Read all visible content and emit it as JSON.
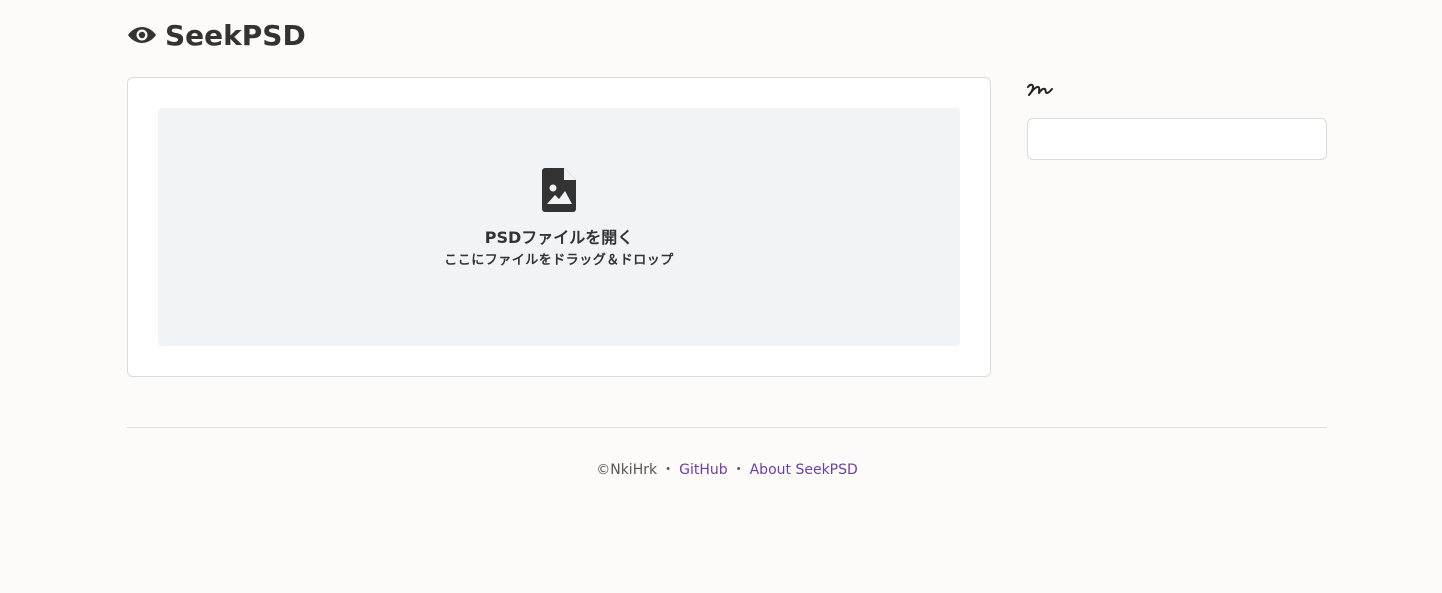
{
  "header": {
    "icon": "eye-icon",
    "title": "SeekPSD"
  },
  "dropzone": {
    "icon": "file-image-icon",
    "label_main": "PSDファイルを開く",
    "label_sub": "ここにファイルをドラッグ＆ドロップ"
  },
  "sidebar": {
    "signature_glyph": "handwritten-signature",
    "search": {
      "value": "",
      "placeholder": ""
    }
  },
  "footer": {
    "copyright": "©NkiHrk",
    "separator": "・",
    "links": [
      {
        "label": "GitHub"
      },
      {
        "label": "About SeekPSD"
      }
    ]
  },
  "colors": {
    "background": "#fcfbfa",
    "card": "#ffffff",
    "dropzone": "#f1f4f7",
    "text": "#333333",
    "link": "#6b3fa0"
  }
}
